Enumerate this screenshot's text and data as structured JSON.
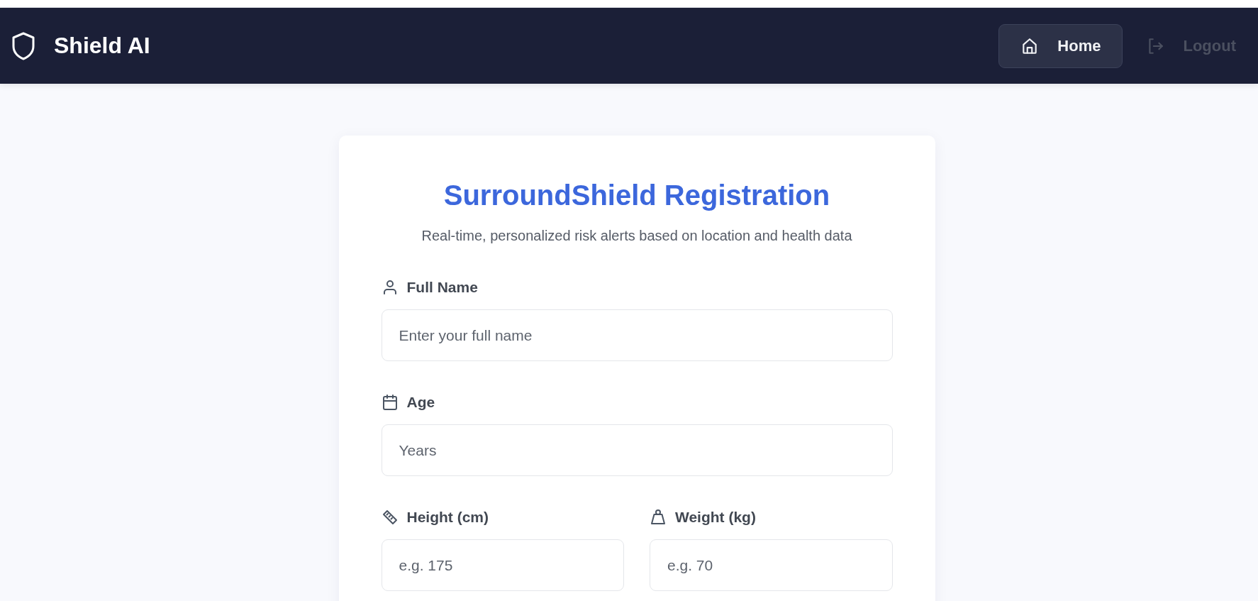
{
  "navbar": {
    "brand": "Shield AI",
    "items": [
      {
        "label": "Home",
        "selected": true
      },
      {
        "label": "Logout",
        "selected": false
      }
    ]
  },
  "form": {
    "title": "SurroundShield Registration",
    "subtitle": "Real-time, personalized risk alerts based on location and health data",
    "rows": [
      [
        {
          "label": "Full Name",
          "placeholder": "Enter your full name"
        }
      ],
      [
        {
          "label": "Age",
          "placeholder": "Years"
        }
      ],
      [
        {
          "label": "Height (cm)",
          "placeholder": "e.g. 175"
        },
        {
          "label": "Weight (kg)",
          "placeholder": "e.g. 70"
        }
      ]
    ]
  }
}
